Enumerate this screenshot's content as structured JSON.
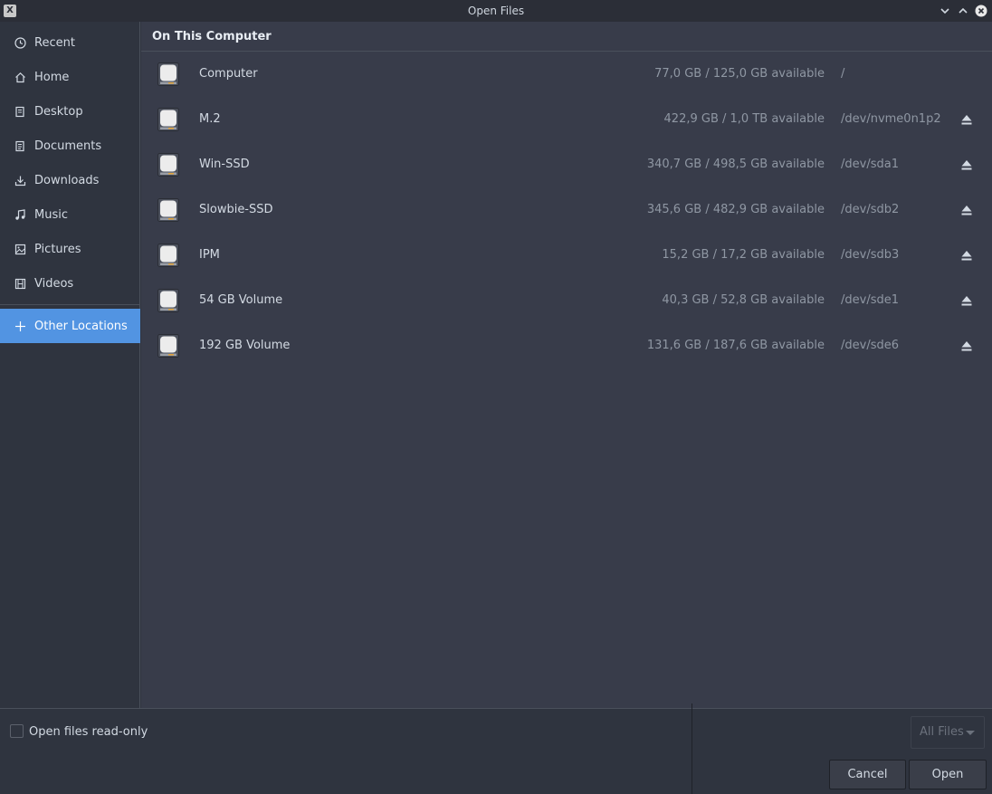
{
  "window": {
    "title": "Open Files",
    "app_icon": "x-icon",
    "controls": [
      "minimize-icon",
      "maximize-icon",
      "close-icon"
    ]
  },
  "sidebar": {
    "items": [
      {
        "label": "Recent",
        "icon": "clock-icon"
      },
      {
        "label": "Home",
        "icon": "home-icon"
      },
      {
        "label": "Desktop",
        "icon": "desktop-icon"
      },
      {
        "label": "Documents",
        "icon": "document-icon"
      },
      {
        "label": "Downloads",
        "icon": "download-icon"
      },
      {
        "label": "Music",
        "icon": "music-icon"
      },
      {
        "label": "Pictures",
        "icon": "picture-icon"
      },
      {
        "label": "Videos",
        "icon": "video-icon"
      }
    ],
    "other": {
      "label": "Other Locations",
      "icon": "plus-icon"
    }
  },
  "main": {
    "section_title": "On This Computer",
    "drives": [
      {
        "name": "Computer",
        "space": "77,0 GB / 125,0 GB available",
        "device": "/",
        "ejectable": false
      },
      {
        "name": "M.2",
        "space": "422,9 GB / 1,0 TB available",
        "device": "/dev/nvme0n1p2",
        "ejectable": true
      },
      {
        "name": "Win-SSD",
        "space": "340,7 GB / 498,5 GB available",
        "device": "/dev/sda1",
        "ejectable": true
      },
      {
        "name": "Slowbie-SSD",
        "space": "345,6 GB / 482,9 GB available",
        "device": "/dev/sdb2",
        "ejectable": true
      },
      {
        "name": "IPM",
        "space": "15,2 GB / 17,2 GB available",
        "device": "/dev/sdb3",
        "ejectable": true
      },
      {
        "name": "54 GB Volume",
        "space": "40,3 GB / 52,8 GB available",
        "device": "/dev/sde1",
        "ejectable": true
      },
      {
        "name": "192 GB Volume",
        "space": "131,6 GB / 187,6 GB available",
        "device": "/dev/sde6",
        "ejectable": true
      }
    ]
  },
  "bottom": {
    "readonly_label": "Open files read-only",
    "readonly_checked": false,
    "filter_value": "All Files",
    "cancel_label": "Cancel",
    "open_label": "Open"
  },
  "colors": {
    "accent": "#5294e2",
    "background": "#383c4a",
    "sidebar": "#2f343f"
  }
}
